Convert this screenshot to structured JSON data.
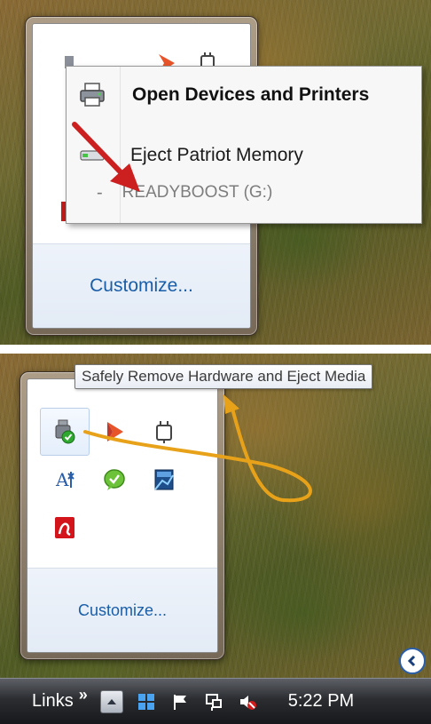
{
  "top_panel": {
    "context_menu": {
      "open_devices_label": "Open Devices and Printers",
      "eject_label": "Eject Patriot Memory",
      "sub_dash": "-",
      "sub_label": "READYBOOST (G:)"
    },
    "customize_label": "Customize...",
    "annotation_arrow_color": "#cc1f1f"
  },
  "bottom_panel": {
    "tooltip": "Safely Remove Hardware and Eject Media",
    "customize_label": "Customize...",
    "tray_icons": [
      {
        "name": "safely-remove-hardware-icon"
      },
      {
        "name": "arrow-app-icon"
      },
      {
        "name": "power-plug-icon"
      },
      {
        "name": "accessibility-icon"
      },
      {
        "name": "green-chat-icon"
      },
      {
        "name": "network-monitor-icon"
      },
      {
        "name": "avira-antivirus-icon"
      }
    ],
    "annotation_arrow_color": "#e8a21a",
    "taskbar": {
      "links_label": "Links",
      "chevron": "»",
      "clock": "5:22 PM"
    }
  }
}
